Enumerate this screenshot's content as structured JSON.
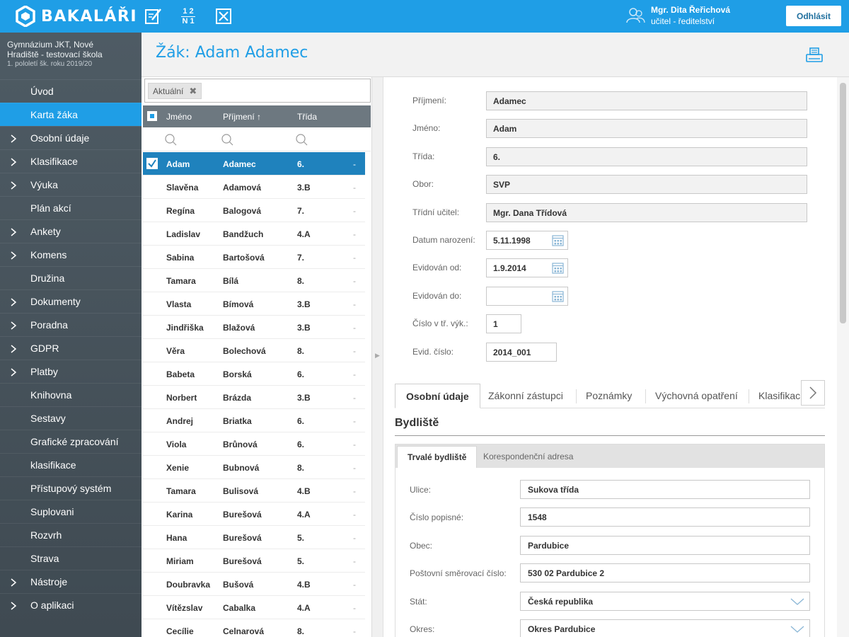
{
  "app": {
    "logo_text": "BAKALÁŘI",
    "logo_icon": "bakalari-hex-logo-icon"
  },
  "topbar": {
    "icons": [
      "edit-notebook-icon",
      "fraction-icon",
      "close-box-icon"
    ],
    "fraction_top": "1 2",
    "fraction_bottom": "N 1",
    "user_name": "Mgr. Dita Řeřichová",
    "user_role": "učitel - ředitelství",
    "logout_label": "Odhlásit"
  },
  "sidebar": {
    "school_line1": "Gymnázium JKT, Nové",
    "school_line2": "Hradiště - testovací škola",
    "period": "1. pololetí šk. roku 2019/20",
    "items": [
      {
        "label": "Úvod",
        "chevron": false
      },
      {
        "label": "Karta žáka",
        "chevron": false,
        "active": true
      },
      {
        "label": "Osobní údaje",
        "chevron": true
      },
      {
        "label": "Klasifikace",
        "chevron": true
      },
      {
        "label": "Výuka",
        "chevron": true
      },
      {
        "label": "Plán akcí",
        "chevron": false
      },
      {
        "label": "Ankety",
        "chevron": true
      },
      {
        "label": "Komens",
        "chevron": true
      },
      {
        "label": "Družina",
        "chevron": false
      },
      {
        "label": "Dokumenty",
        "chevron": true
      },
      {
        "label": "Poradna",
        "chevron": true
      },
      {
        "label": "GDPR",
        "chevron": true
      },
      {
        "label": "Platby",
        "chevron": true
      },
      {
        "label": "Knihovna",
        "chevron": false
      },
      {
        "label": "Sestavy",
        "chevron": false
      },
      {
        "label": "Grafické zpracování",
        "chevron": false
      },
      {
        "label": "klasifikace",
        "chevron": false
      },
      {
        "label": "Přístupový systém",
        "chevron": false
      },
      {
        "label": "Suplovani",
        "chevron": false
      },
      {
        "label": "Rozvrh",
        "chevron": false
      },
      {
        "label": "Strava",
        "chevron": false
      },
      {
        "label": "Nástroje",
        "chevron": true
      },
      {
        "label": "O aplikaci",
        "chevron": true
      }
    ]
  },
  "header": {
    "title": "Žák: Adam Adamec"
  },
  "student_list": {
    "filter_tag": "Aktuální",
    "columns": {
      "first": "Jméno",
      "last": "Příjmení ↑",
      "class": "Třída"
    },
    "rows": [
      {
        "first": "Adam",
        "last": "Adamec",
        "class": "6.",
        "selected": true
      },
      {
        "first": "Slavěna",
        "last": "Adamová",
        "class": "3.B"
      },
      {
        "first": "Regína",
        "last": "Balogová",
        "class": "7."
      },
      {
        "first": "Ladislav",
        "last": "Bandžuch",
        "class": "4.A"
      },
      {
        "first": "Sabina",
        "last": "Bartošová",
        "class": "7."
      },
      {
        "first": "Tamara",
        "last": "Bílá",
        "class": "8."
      },
      {
        "first": "Vlasta",
        "last": "Bímová",
        "class": "3.B"
      },
      {
        "first": "Jindřiška",
        "last": "Blažová",
        "class": "3.B"
      },
      {
        "first": "Věra",
        "last": "Bolechová",
        "class": "8."
      },
      {
        "first": "Babeta",
        "last": "Borská",
        "class": "6."
      },
      {
        "first": "Norbert",
        "last": "Brázda",
        "class": "3.B"
      },
      {
        "first": "Andrej",
        "last": "Briatka",
        "class": "6."
      },
      {
        "first": "Viola",
        "last": "Brůnová",
        "class": "6."
      },
      {
        "first": "Xenie",
        "last": "Bubnová",
        "class": "8."
      },
      {
        "first": "Tamara",
        "last": "Bulisová",
        "class": "4.B"
      },
      {
        "first": "Karina",
        "last": "Burešová",
        "class": "4.A"
      },
      {
        "first": "Hana",
        "last": "Burešová",
        "class": "5."
      },
      {
        "first": "Miriam",
        "last": "Burešová",
        "class": "5."
      },
      {
        "first": "Doubravka",
        "last": "Bušová",
        "class": "4.B"
      },
      {
        "first": "Vítězslav",
        "last": "Cabalka",
        "class": "4.A"
      },
      {
        "first": "Cecílie",
        "last": "Celnarová",
        "class": "8."
      }
    ],
    "row_marker": "-"
  },
  "detail": {
    "fields": [
      {
        "label": "Příjmení:",
        "value": "Adamec",
        "type": "text"
      },
      {
        "label": "Jméno:",
        "value": "Adam",
        "type": "text"
      },
      {
        "label": "Třída:",
        "value": "6.",
        "type": "text"
      },
      {
        "label": "Obor:",
        "value": "SVP",
        "type": "text"
      },
      {
        "label": "Třídní učitel:",
        "value": "Mgr. Dana  Třídová",
        "type": "text"
      },
      {
        "label": "Datum narození:",
        "value": "5.11.1998",
        "type": "date"
      },
      {
        "label": "Evidován od:",
        "value": "1.9.2014",
        "type": "date"
      },
      {
        "label": "Evidován do:",
        "value": "",
        "type": "date"
      },
      {
        "label": "Číslo v tř. výk.:",
        "value": "1",
        "type": "small"
      },
      {
        "label": "Evid. číslo:",
        "value": "2014_001",
        "type": "medium"
      }
    ],
    "tabs": [
      "Osobní údaje",
      "Zákonní zástupci",
      "Poznámky",
      "Výchovná opatření",
      "Klasifikac"
    ],
    "section_title": "Bydliště",
    "subtabs": [
      "Trvalé bydliště",
      "Korespondenční adresa"
    ],
    "address": [
      {
        "label": "Ulice:",
        "value": "Sukova třída",
        "dropdown": false
      },
      {
        "label": "Číslo popisné:",
        "value": "1548",
        "dropdown": false
      },
      {
        "label": "Obec:",
        "value": "Pardubice",
        "dropdown": false
      },
      {
        "label": "Poštovní směrovací číslo:",
        "value": "530 02 Pardubice 2",
        "dropdown": false
      },
      {
        "label": "Stát:",
        "value": "Česká republika",
        "dropdown": true
      },
      {
        "label": "Okres:",
        "value": "Okres Pardubice",
        "dropdown": true
      }
    ]
  },
  "colors": {
    "accent": "#1f9ee6",
    "selected_row": "#1f82bd",
    "sidebar": "#4e5b64",
    "list_header": "#6d7880"
  }
}
